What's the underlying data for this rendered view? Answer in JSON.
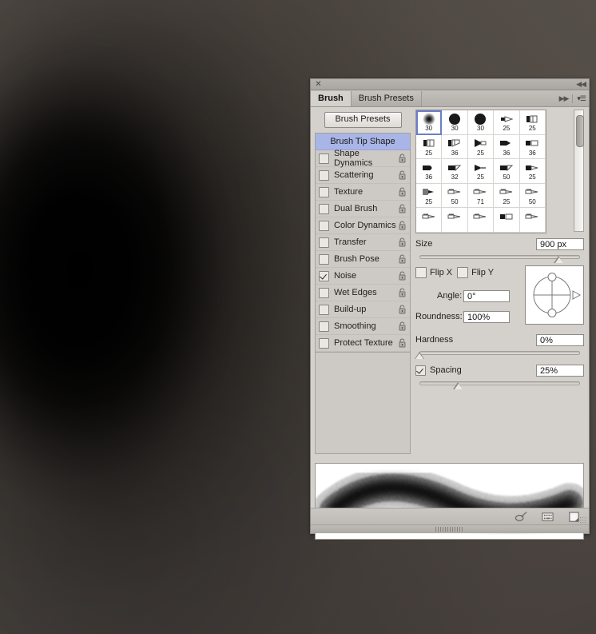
{
  "window": {
    "title": "Brush",
    "close_icon": "close-icon",
    "collapse_icon": "collapse-arrows-icon",
    "expand_icon": "expand-arrows-icon",
    "menu_icon": "panel-menu-icon"
  },
  "tabs": [
    {
      "label": "Brush",
      "active": true
    },
    {
      "label": "Brush Presets",
      "active": false
    }
  ],
  "sidebar": {
    "presets_button": "Brush Presets",
    "header": "Brush Tip Shape",
    "items": [
      {
        "label": "Shape Dynamics",
        "checked": false,
        "locked": true
      },
      {
        "label": "Scattering",
        "checked": false,
        "locked": true
      },
      {
        "label": "Texture",
        "checked": false,
        "locked": true
      },
      {
        "label": "Dual Brush",
        "checked": false,
        "locked": true
      },
      {
        "label": "Color Dynamics",
        "checked": false,
        "locked": true
      },
      {
        "label": "Transfer",
        "checked": false,
        "locked": true
      },
      {
        "label": "Brush Pose",
        "checked": false,
        "locked": true
      },
      {
        "label": "Noise",
        "checked": true,
        "locked": true
      },
      {
        "label": "Wet Edges",
        "checked": false,
        "locked": true
      },
      {
        "label": "Build-up",
        "checked": false,
        "locked": true
      },
      {
        "label": "Smoothing",
        "checked": false,
        "locked": true
      },
      {
        "label": "Protect Texture",
        "checked": false,
        "locked": true
      }
    ]
  },
  "brush_grid": {
    "columns": 5,
    "scroll_position": 0.03,
    "tips": [
      {
        "size": "30",
        "shape": "soft-round",
        "selected": true
      },
      {
        "size": "30",
        "shape": "hard-round",
        "selected": false
      },
      {
        "size": "30",
        "shape": "hard-round",
        "selected": false
      },
      {
        "size": "25",
        "shape": "flat-tip",
        "selected": false
      },
      {
        "size": "25",
        "shape": "square-bristle",
        "selected": false
      },
      {
        "size": "25",
        "shape": "square-bristle",
        "selected": false
      },
      {
        "size": "36",
        "shape": "angled-bristle",
        "selected": false
      },
      {
        "size": "25",
        "shape": "fan-bristle",
        "selected": false
      },
      {
        "size": "36",
        "shape": "point-bristle",
        "selected": false
      },
      {
        "size": "36",
        "shape": "flat-bristle",
        "selected": false
      },
      {
        "size": "36",
        "shape": "round-point",
        "selected": false
      },
      {
        "size": "32",
        "shape": "angled-flat",
        "selected": false
      },
      {
        "size": "25",
        "shape": "fan-thin",
        "selected": false
      },
      {
        "size": "50",
        "shape": "angled-flat",
        "selected": false
      },
      {
        "size": "25",
        "shape": "round-taper",
        "selected": false
      },
      {
        "size": "25",
        "shape": "blunt-round",
        "selected": false
      },
      {
        "size": "50",
        "shape": "thin-liner",
        "selected": false
      },
      {
        "size": "71",
        "shape": "thin-liner",
        "selected": false
      },
      {
        "size": "25",
        "shape": "thin-liner",
        "selected": false
      },
      {
        "size": "50",
        "shape": "thin-liner",
        "selected": false
      },
      {
        "size": "",
        "shape": "thin-liner",
        "selected": false
      },
      {
        "size": "",
        "shape": "thin-liner",
        "selected": false
      },
      {
        "size": "",
        "shape": "thin-liner",
        "selected": false
      },
      {
        "size": "",
        "shape": "flat-bristle",
        "selected": false
      },
      {
        "size": "",
        "shape": "thin-liner",
        "selected": false
      }
    ]
  },
  "controls": {
    "size": {
      "label": "Size",
      "value": "900 px",
      "slider_pct": 90
    },
    "flip_x": {
      "label": "Flip X",
      "checked": false
    },
    "flip_y": {
      "label": "Flip Y",
      "checked": false
    },
    "angle": {
      "label": "Angle:",
      "value": "0°"
    },
    "roundness": {
      "label": "Roundness:",
      "value": "100%"
    },
    "hardness": {
      "label": "Hardness",
      "value": "0%",
      "slider_pct": 0
    },
    "spacing": {
      "label": "Spacing",
      "value": "25%",
      "checked": true,
      "slider_pct": 25
    },
    "angle_widget": "angle-roundness-dial"
  },
  "footer": {
    "icons": [
      "brush-tool-icon",
      "new-preset-panel-icon",
      "new-brush-icon"
    ],
    "resize_grip": "resize-grip-icon",
    "bottom_grip": "panel-drag-grip"
  },
  "colors": {
    "panel_bg": "#d4d0cb",
    "selected_row": "#a9b5e6",
    "desktop": "#56504c",
    "field_bg": "#ffffff"
  }
}
